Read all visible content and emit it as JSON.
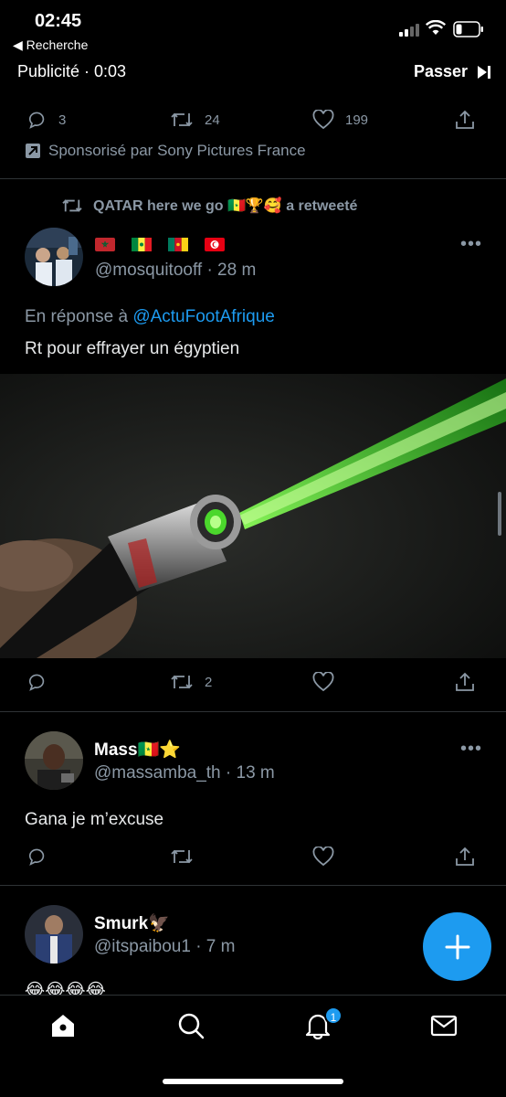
{
  "status_bar": {
    "time": "02:45",
    "back_label": "◀ Recherche"
  },
  "ad": {
    "label": "Publicité · 0:03",
    "skip_label": "Passer",
    "stats": {
      "replies": "3",
      "retweets": "24",
      "likes": "199"
    },
    "sponsor_text": "Sponsorisé par Sony Pictures France"
  },
  "tweet1": {
    "retweeted_by": "QATAR here we go 🇸🇳🏆🥰 a retweeté",
    "name_flags": [
      "Morocco",
      "Senegal",
      "Cameroon",
      "Tunisia"
    ],
    "handle_time": "@mosquitooff · 28 m",
    "reply_prefix": "En réponse à",
    "reply_handle": "@ActuFootAfrique",
    "text": "Rt pour effrayer un égyptien",
    "stats": {
      "retweets": "2"
    }
  },
  "tweet2": {
    "name": "Mass🇸🇳⭐",
    "handle_time": "@massamba_th · 13 m",
    "text": "Gana je m’excuse"
  },
  "tweet3": {
    "name": "Smurk🦅",
    "handle_time": "@itspaibou1 · 7 m",
    "text": "😂😂😂😂"
  },
  "nav": {
    "notifications_badge": "1"
  },
  "colors": {
    "accent": "#1d9bf0",
    "muted": "#8b98a5",
    "background": "#000000"
  }
}
